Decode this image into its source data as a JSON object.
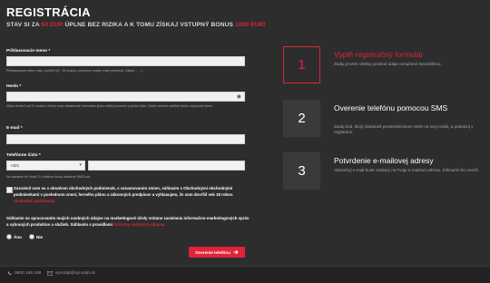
{
  "title": "REGISTRÁCIA",
  "subtitle": {
    "part1": "STAV SI ZA ",
    "amount1": "50 EUR",
    "part2": " ÚPLNE BEZ RIZIKA A K TOMU ZÍSKAJ VSTUPNÝ BONUS ",
    "amount2": "1000 EUR!"
  },
  "form": {
    "username_label": "Prihlasovacie meno *",
    "username_hint": "Prihlasovacie meno, napr. jozef24 (8 - 15 znakov, povolené znaky: malé písmena, číslice, . , - )",
    "password_label": "Heslo *",
    "password_hint": "Dĺžka hesla 6 až 20 znakov. Heslo musí obsahovať minimálne jedno veľké písmeno a jedno číslo. Heslo nesmie zahŕňať alebo kopírovať meno",
    "email_label": "E-mail *",
    "phone_label": "Telefónne číslo *",
    "phone_prefix": "+421",
    "phone_hint": "Na zaslanie tel. čísla Ti v ďalšom kroku zašleme SMS kód.",
    "terms_text": "Zoznámil som sa s obsahom obchodných podmienok, s oznamovaním zmien, súhlasím s Obchodnými obchodnými podmienkami v poslednom znení, herného plánu a zákonných predpisov a vyhlasujem, že som dovŕšil vek 18 rokov. ",
    "terms_link": "obchodné podmienky",
    "consent_text": "Súhlasím so spracovaním mojich osobných údajov na marketingové účely vrátane zasielania informačno-marketingových správ a vybraných produktov a služieb. Súhlasím s pravidlami ",
    "consent_link": "Ochrany osobných údajov",
    "consent_end": ".",
    "yes_label": "Áno",
    "no_label": "Nie",
    "submit_label": "Overenie telefónu"
  },
  "steps": [
    {
      "number": "1",
      "title": "Vyplň registračný formulár",
      "text": "Zadaj prosím všetky povinné údaje označené hviezdičkou."
    },
    {
      "number": "2",
      "title": "Overenie telefónu pomocou SMS",
      "text": "Zadaj kód, ktorý dostaneš prostredníctvom SMS na svoj mobil, a pokračuj v registrácii."
    },
    {
      "number": "3",
      "title": "Potvrdenie e-mailovej adresy",
      "text": "Aktivačný e-mail bude zaslaný na Tvoju e-mailovú adresu. Kliknutím ho overíš."
    }
  ],
  "footer": {
    "phone": "0800 198 198",
    "email": "synottip@synottip.sk"
  },
  "colors": {
    "accent": "#e02438",
    "background": "#2d2d2d"
  }
}
